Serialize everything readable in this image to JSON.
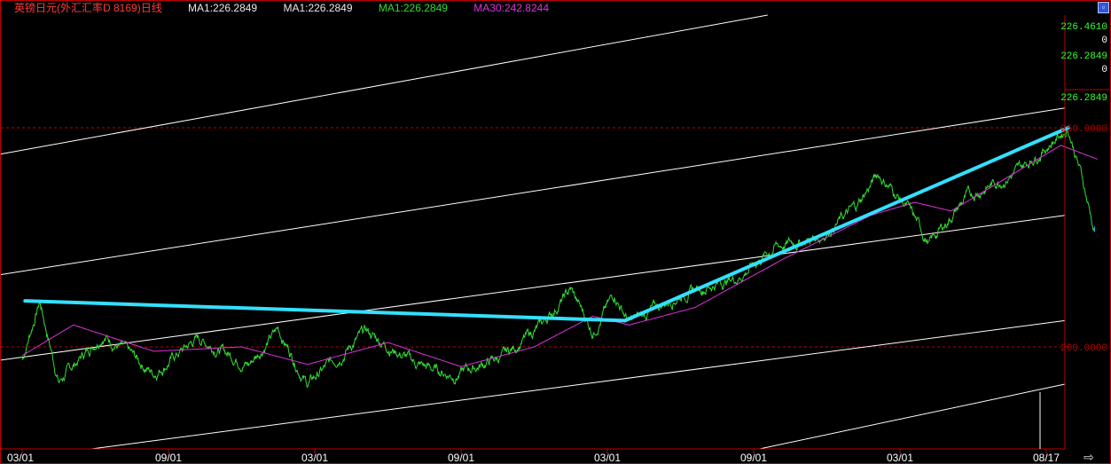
{
  "header": {
    "title": "英镑日元(外汇汇率D 8169)日线",
    "ma_labels": [
      "MA1:226.2849",
      "MA1:226.2849",
      "MA1:226.2849",
      "MA30:242.8244"
    ]
  },
  "right_axis": {
    "readouts": [
      "226.4610",
      "0",
      "226.2849",
      "0",
      "226.2849"
    ],
    "tick_labels": [
      "250.0000",
      "200.0000"
    ]
  },
  "colors": {
    "title": "#ff3b3b",
    "ma1": "#33dd33",
    "ma30": "#dd33dd",
    "trendline": "#33e0ff",
    "channel": "#ffffff",
    "grid": "#c00000"
  },
  "icons": {
    "corner": "restore-icon",
    "scroll": "scroll-right-arrow-icon"
  },
  "chart_data": {
    "type": "line",
    "x_tick_labels": [
      "03/01",
      "09/01",
      "03/01",
      "09/01",
      "03/01",
      "09/01",
      "03/01",
      "08/17"
    ],
    "y_tick_values": [
      250,
      200
    ],
    "ylim": [
      176,
      300
    ],
    "trendlines": [
      {
        "from": {
          "x_index": 0.02,
          "y": 210.5
        },
        "to": {
          "x_index": 4.12,
          "y": 206.0
        }
      },
      {
        "from": {
          "x_index": 4.12,
          "y": 206.0
        },
        "to": {
          "x_index": 7.15,
          "y": 250.0
        }
      }
    ],
    "price_series_key_points": [
      {
        "x_index": 0.0,
        "y": 197.0
      },
      {
        "x_index": 0.12,
        "y": 210.5
      },
      {
        "x_index": 0.25,
        "y": 192.0
      },
      {
        "x_index": 0.55,
        "y": 203.0
      },
      {
        "x_index": 0.9,
        "y": 194.0
      },
      {
        "x_index": 1.2,
        "y": 202.0
      },
      {
        "x_index": 1.55,
        "y": 196.0
      },
      {
        "x_index": 1.75,
        "y": 204.0
      },
      {
        "x_index": 1.95,
        "y": 191.5
      },
      {
        "x_index": 2.35,
        "y": 203.5
      },
      {
        "x_index": 2.7,
        "y": 196.0
      },
      {
        "x_index": 2.95,
        "y": 193.5
      },
      {
        "x_index": 3.3,
        "y": 198.0
      },
      {
        "x_index": 3.55,
        "y": 205.0
      },
      {
        "x_index": 3.75,
        "y": 213.0
      },
      {
        "x_index": 3.9,
        "y": 203.5
      },
      {
        "x_index": 4.05,
        "y": 212.0
      },
      {
        "x_index": 4.15,
        "y": 205.5
      },
      {
        "x_index": 4.5,
        "y": 212.0
      },
      {
        "x_index": 4.9,
        "y": 216.0
      },
      {
        "x_index": 5.15,
        "y": 223.0
      },
      {
        "x_index": 5.45,
        "y": 225.0
      },
      {
        "x_index": 5.7,
        "y": 232.0
      },
      {
        "x_index": 5.85,
        "y": 239.5
      },
      {
        "x_index": 6.05,
        "y": 232.0
      },
      {
        "x_index": 6.2,
        "y": 223.5
      },
      {
        "x_index": 6.45,
        "y": 234.0
      },
      {
        "x_index": 6.8,
        "y": 240.0
      },
      {
        "x_index": 7.15,
        "y": 250.0
      },
      {
        "x_index": 7.25,
        "y": 238.0
      },
      {
        "x_index": 7.33,
        "y": 226.28
      }
    ],
    "ma30_key_points": [
      {
        "x_index": 0.0,
        "y": 198.0
      },
      {
        "x_index": 0.35,
        "y": 205.0
      },
      {
        "x_index": 0.9,
        "y": 199.0
      },
      {
        "x_index": 1.5,
        "y": 200.0
      },
      {
        "x_index": 1.95,
        "y": 196.0
      },
      {
        "x_index": 2.5,
        "y": 201.0
      },
      {
        "x_index": 3.0,
        "y": 195.5
      },
      {
        "x_index": 3.5,
        "y": 200.0
      },
      {
        "x_index": 3.9,
        "y": 207.0
      },
      {
        "x_index": 4.15,
        "y": 205.0
      },
      {
        "x_index": 4.6,
        "y": 209.0
      },
      {
        "x_index": 5.2,
        "y": 220.0
      },
      {
        "x_index": 5.8,
        "y": 230.0
      },
      {
        "x_index": 6.1,
        "y": 233.0
      },
      {
        "x_index": 6.35,
        "y": 231.0
      },
      {
        "x_index": 6.8,
        "y": 240.0
      },
      {
        "x_index": 7.1,
        "y": 246.0
      },
      {
        "x_index": 7.35,
        "y": 242.82
      }
    ],
    "channel_lines": [
      {
        "start_y": 197.0,
        "end_y": 230.0
      },
      {
        "start_y": 216.5,
        "end_y": 254.5
      },
      {
        "start_y": 244.0,
        "end_y": 288.0
      },
      {
        "start_y": 174.0,
        "end_y": 206.0
      },
      {
        "start_y": 140.0,
        "end_y": 191.5
      }
    ]
  }
}
